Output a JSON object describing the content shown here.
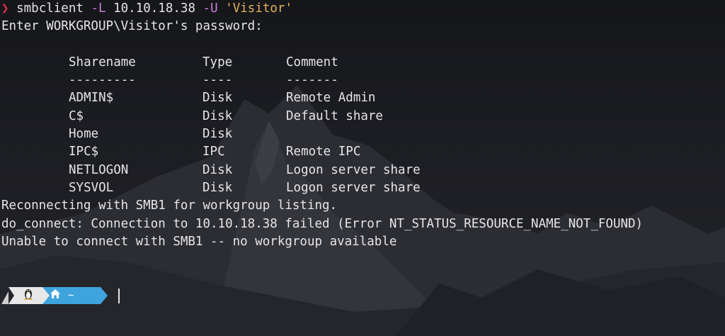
{
  "colors": {
    "background": "#1c1d22",
    "text": "#e6e6e6",
    "prompt_arrow": "#e0314b",
    "flag": "#c87fd6",
    "string": "#e0b15e",
    "powerline_os": "#e8e8e8",
    "powerline_path": "#3fa4dd"
  },
  "command": {
    "prompt_symbol": "❯",
    "name": "smbclient",
    "flag_list": "-L",
    "host": "10.10.18.38",
    "flag_user": "-U",
    "user": "'Visitor'"
  },
  "password_prompt": "Enter WORKGROUP\\Visitor's password:",
  "shares": {
    "headers": [
      "Sharename",
      "Type",
      "Comment"
    ],
    "separators": [
      "---------",
      "----",
      "-------"
    ],
    "rows": [
      [
        "ADMIN$",
        "Disk",
        "Remote Admin"
      ],
      [
        "C$",
        "Disk",
        "Default share"
      ],
      [
        "Home",
        "Disk",
        ""
      ],
      [
        "IPC$",
        "IPC",
        "Remote IPC"
      ],
      [
        "NETLOGON",
        "Disk",
        "Logon server share"
      ],
      [
        "SYSVOL",
        "Disk",
        "Logon server share"
      ]
    ]
  },
  "messages": [
    "Reconnecting with SMB1 for workgroup listing.",
    "do_connect: Connection to 10.10.18.38 failed (Error NT_STATUS_RESOURCE_NAME_NOT_FOUND)",
    "Unable to connect with SMB1 -- no workgroup available"
  ],
  "powerline": {
    "os_icon": "linux-penguin-icon",
    "home_icon": "home-icon",
    "path": "~"
  }
}
